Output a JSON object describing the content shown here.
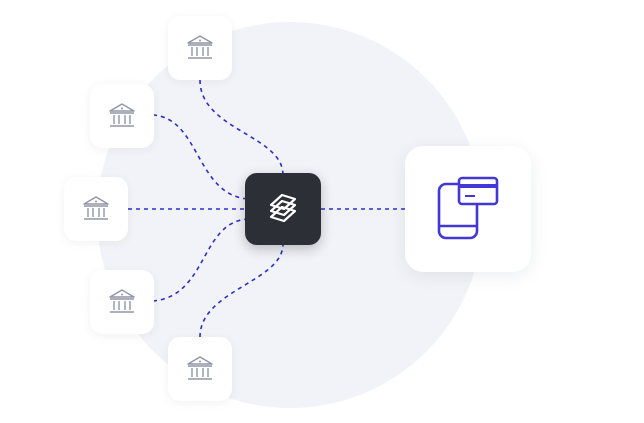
{
  "diagram": {
    "nodes": [
      {
        "id": "bank-1",
        "icon": "bank-icon"
      },
      {
        "id": "bank-2",
        "icon": "bank-icon"
      },
      {
        "id": "bank-3",
        "icon": "bank-icon"
      },
      {
        "id": "bank-4",
        "icon": "bank-icon"
      },
      {
        "id": "bank-5",
        "icon": "bank-icon"
      },
      {
        "id": "hub",
        "icon": "stacked-layers-logo-icon"
      },
      {
        "id": "device",
        "icon": "phone-card-icon"
      }
    ],
    "edges": [
      [
        "bank-1",
        "hub"
      ],
      [
        "bank-2",
        "hub"
      ],
      [
        "bank-3",
        "hub"
      ],
      [
        "bank-4",
        "hub"
      ],
      [
        "bank-5",
        "hub"
      ],
      [
        "hub",
        "device"
      ]
    ],
    "colors": {
      "connector": "#2b2fc8",
      "accent": "#4338d6",
      "bank_icon": "#8f95a6",
      "hub_bg": "#2c2f36",
      "background_circle": "#f2f3f8"
    }
  }
}
